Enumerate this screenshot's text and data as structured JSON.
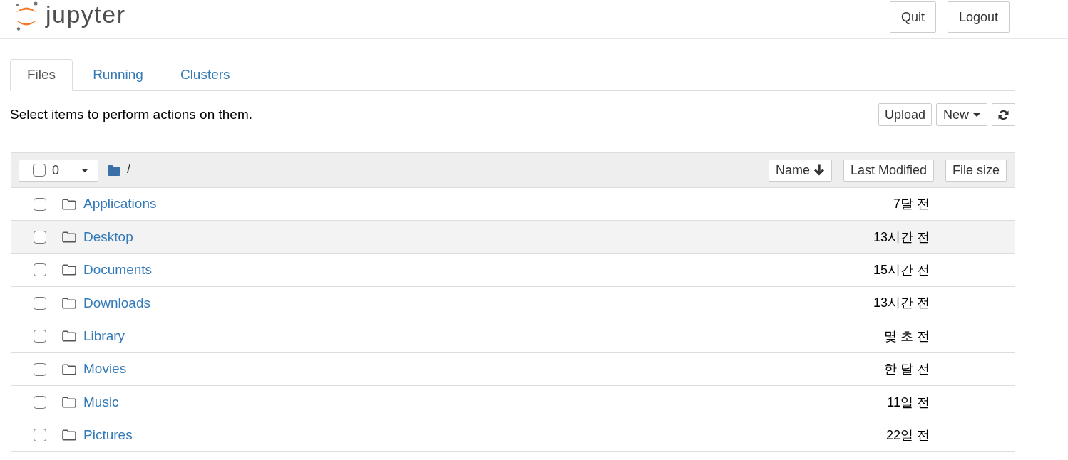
{
  "header": {
    "logo_text": "jupyter",
    "buttons": [
      "Quit",
      "Logout"
    ]
  },
  "tabs": [
    {
      "label": "Files",
      "selected": true
    },
    {
      "label": "Running",
      "selected": false
    },
    {
      "label": "Clusters",
      "selected": false
    }
  ],
  "toolbar": {
    "hint": "Select items to perform actions on them.",
    "buttons": [
      {
        "kind": "text",
        "label": "Upload"
      },
      {
        "kind": "dropdown",
        "label": "New"
      },
      {
        "kind": "refresh"
      }
    ]
  },
  "file_list": {
    "select_all": {
      "checked": false,
      "count": "0"
    },
    "breadcrumb": "/",
    "sort_buttons": [
      {
        "label": "Name",
        "sorted": true
      },
      {
        "label": "Last Modified",
        "sorted": false
      },
      {
        "label": "File size",
        "sorted": false
      }
    ],
    "rows": [
      {
        "name": "Applications",
        "modified": "7달 전",
        "checked": false,
        "hovered": false
      },
      {
        "name": "Desktop",
        "modified": "13시간 전",
        "checked": false,
        "hovered": true
      },
      {
        "name": "Documents",
        "modified": "15시간 전",
        "checked": false,
        "hovered": false
      },
      {
        "name": "Downloads",
        "modified": "13시간 전",
        "checked": false,
        "hovered": false
      },
      {
        "name": "Library",
        "modified": "몇 초 전",
        "checked": false,
        "hovered": false
      },
      {
        "name": "Movies",
        "modified": "한 달 전",
        "checked": false,
        "hovered": false
      },
      {
        "name": "Music",
        "modified": "11일 전",
        "checked": false,
        "hovered": false
      },
      {
        "name": "Pictures",
        "modified": "22일 전",
        "checked": false,
        "hovered": false
      }
    ]
  }
}
